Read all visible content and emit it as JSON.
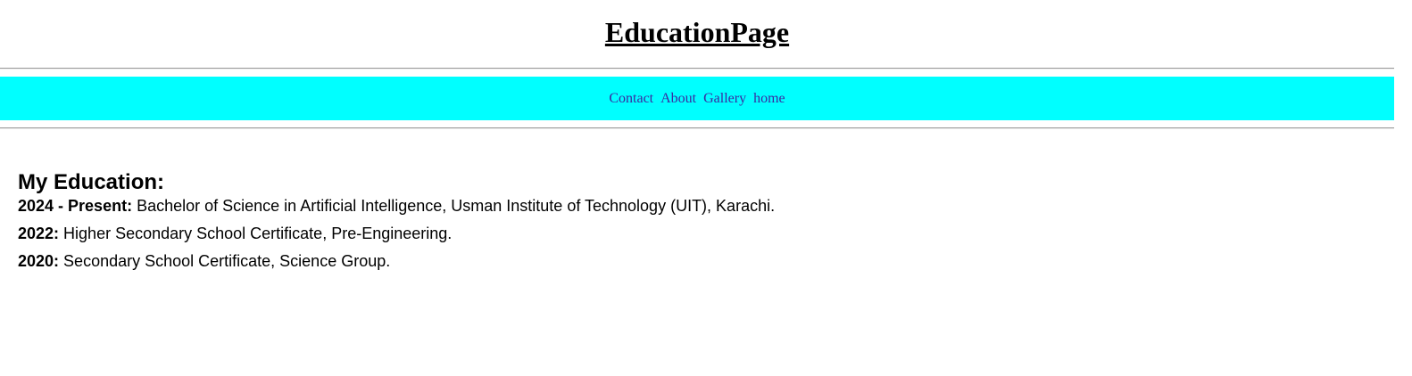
{
  "header": {
    "title": "EducationPage"
  },
  "nav": {
    "items": [
      {
        "label": "Contact"
      },
      {
        "label": "About"
      },
      {
        "label": "Gallery"
      },
      {
        "label": "home"
      }
    ]
  },
  "main": {
    "heading": "My Education:",
    "entries": [
      {
        "label": "2024 - Present:",
        "text": " Bachelor of Science in Artificial Intelligence, Usman Institute of Technology (UIT), Karachi."
      },
      {
        "label": "2022:",
        "text": " Higher Secondary School Certificate, Pre-Engineering."
      },
      {
        "label": "2020:",
        "text": " Secondary School Certificate, Science Group."
      }
    ]
  },
  "colors": {
    "nav_background": "#00ffff",
    "nav_link": "#3a2aa0",
    "text": "#000000"
  }
}
